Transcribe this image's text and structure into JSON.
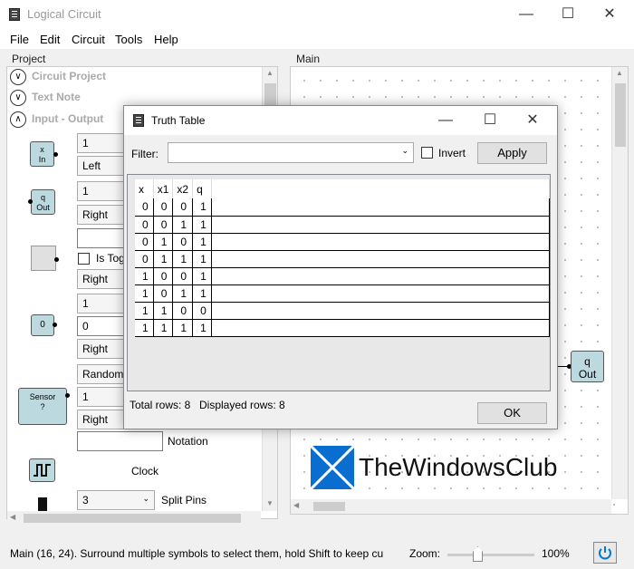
{
  "window": {
    "title": "Logical Circuit"
  },
  "menu": [
    "File",
    "Edit",
    "Circuit",
    "Tools",
    "Help"
  ],
  "project_panel": {
    "label": "Project",
    "sections": [
      "Circuit Project",
      "Text Note",
      "Input - Output"
    ],
    "items": {
      "input_sym": "x\nIn",
      "combo_1a": "1",
      "combo_1b": "Left",
      "output_sym": "q\nOut",
      "combo_2a": "1",
      "combo_2b": "Right",
      "toggle_label": "Is Tog",
      "combo_3": "Right",
      "const_sym": "0",
      "combo_4a": "1",
      "combo_4b": "0",
      "combo_4c": "Right",
      "combo_4d": "Random",
      "sensor_sym": "Sensor\n?",
      "combo_5a": "1",
      "combo_5b": "Right",
      "notation_label": "Notation",
      "clock_label": "Clock",
      "split_value": "3",
      "split_label": "Split Pins"
    }
  },
  "main_panel": {
    "label": "Main",
    "out_symbol": "q\nOut"
  },
  "truth_dialog": {
    "title": "Truth Table",
    "filter_label": "Filter:",
    "filter_value": "",
    "invert_label": "Invert",
    "apply_label": "Apply",
    "columns": [
      "x",
      "x1",
      "x2",
      "q"
    ],
    "rows": [
      [
        "0",
        "0",
        "0",
        "1"
      ],
      [
        "0",
        "0",
        "1",
        "1"
      ],
      [
        "0",
        "1",
        "0",
        "1"
      ],
      [
        "0",
        "1",
        "1",
        "1"
      ],
      [
        "1",
        "0",
        "0",
        "1"
      ],
      [
        "1",
        "0",
        "1",
        "1"
      ],
      [
        "1",
        "1",
        "0",
        "0"
      ],
      [
        "1",
        "1",
        "1",
        "1"
      ]
    ],
    "total_rows": "Total rows: 8",
    "displayed_rows": "Displayed rows: 8",
    "ok_label": "OK"
  },
  "status": {
    "text": "Main (16, 24). Surround multiple symbols to select them, hold Shift to keep cu",
    "zoom_label": "Zoom:",
    "zoom_value": "100%",
    "zoom_level": 0.5
  },
  "watermark": "TheWindowsClub",
  "colors": {
    "symbol_fill": "#bcd9e0",
    "accent": "#0078d7"
  }
}
